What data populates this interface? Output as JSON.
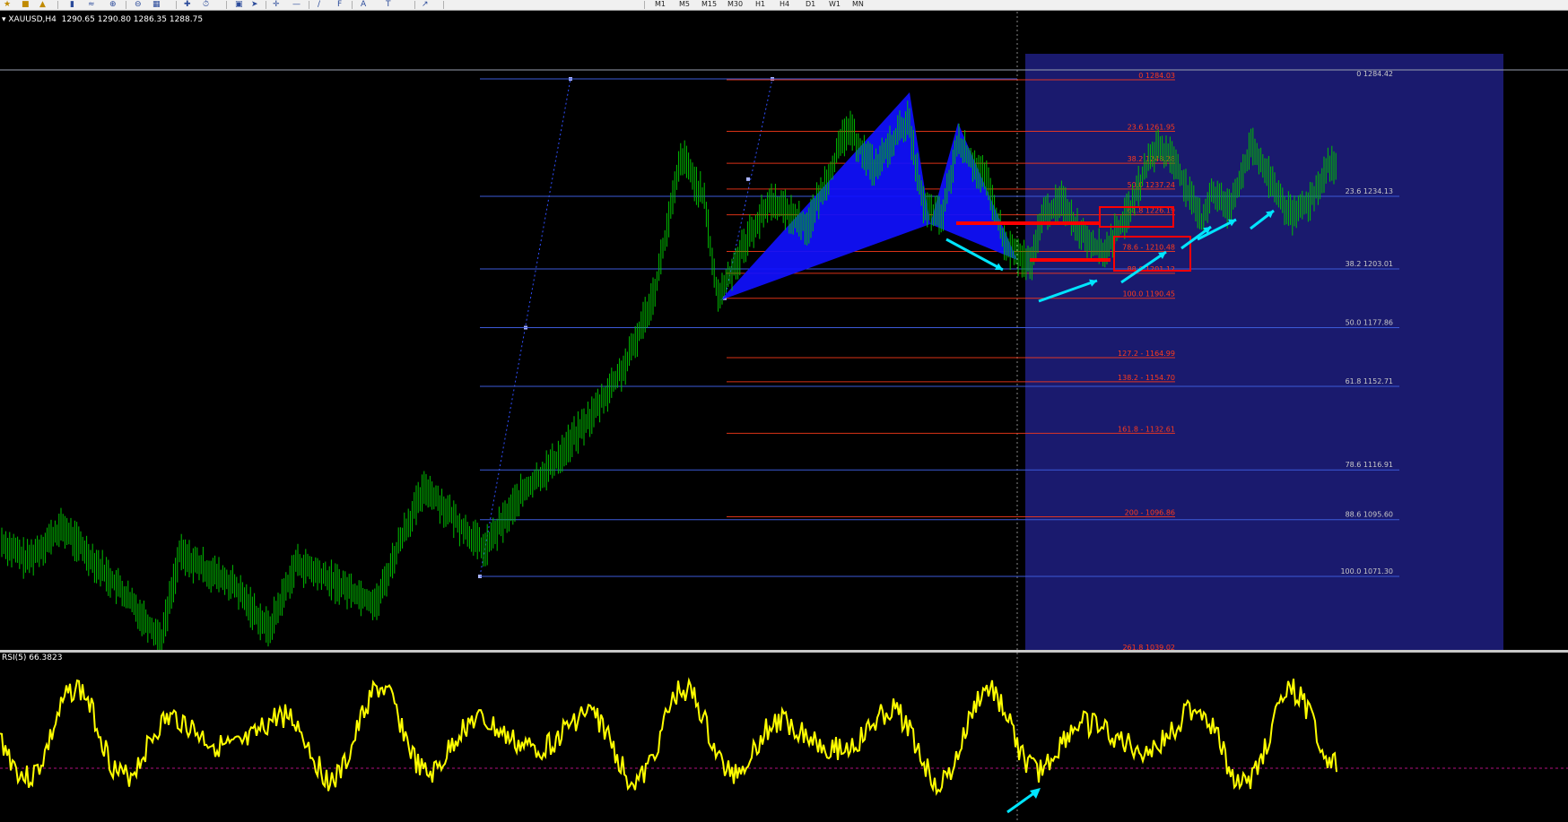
{
  "toolbar": {
    "timeframes": [
      "M1",
      "M5",
      "M15",
      "M30",
      "H1",
      "H4",
      "D1",
      "W1",
      "MN"
    ],
    "icons": [
      "new-order-icon",
      "profiles-icon",
      "bar-chart-icon",
      "candle-chart-icon",
      "line-chart-icon",
      "zoom-in-icon",
      "zoom-out-icon",
      "tile-icon",
      "indicators-icon",
      "periods-icon",
      "templates-icon",
      "cursor-icon",
      "crosshair-icon",
      "hline-icon",
      "trendline-icon",
      "fibo-icon",
      "text-icon",
      "label-icon",
      "arrow-icon"
    ]
  },
  "chart": {
    "header": "XAUUSD,H4  1290.65 1290.80 1286.35 1288.75",
    "symbol": "XAUUSD,H4",
    "ohlc": "1290.65 1290.80 1286.35 1288.75",
    "price_line_label": "0 1284.42",
    "fib_blue_levels": [
      {
        "label": "0 1284.42",
        "value": 1284.42
      },
      {
        "label": "23.6 1234.13",
        "value": 1234.13
      },
      {
        "label": "38.2 1203.01",
        "value": 1203.01
      },
      {
        "label": "50.0 1177.86",
        "value": 1177.86
      },
      {
        "label": "61.8 1152.71",
        "value": 1152.71
      },
      {
        "label": "78.6 1116.91",
        "value": 1116.91
      },
      {
        "label": "88.6 1095.60",
        "value": 1095.6
      },
      {
        "label": "100.0 1071.30",
        "value": 1071.3
      }
    ],
    "fib_red_levels": [
      {
        "label": "0 1284.03",
        "value": 1284.03
      },
      {
        "label": "23.6 1261.95",
        "value": 1261.95
      },
      {
        "label": "38.2 1248.28",
        "value": 1248.28
      },
      {
        "label": "50.0 1237.24",
        "value": 1237.24
      },
      {
        "label": "61.8 1226.19",
        "value": 1226.19
      },
      {
        "label": "78.6 - 1210.48",
        "value": 1210.48
      },
      {
        "label": "88.6 1201.12",
        "value": 1201.12
      },
      {
        "label": "100.0 1190.45",
        "value": 1190.45
      },
      {
        "label": "127.2 - 1164.99",
        "value": 1164.99
      },
      {
        "label": "138.2 - 1154.70",
        "value": 1154.7
      },
      {
        "label": "161.8 - 1132.61",
        "value": 1132.61
      },
      {
        "label": "200 - 1096.86",
        "value": 1096.86
      },
      {
        "label": "261.8 1039.02",
        "value": 1039.02
      }
    ],
    "colors": {
      "background": "#000000",
      "candles": "#00c000",
      "rsi_line": "#ffff00",
      "fib_blue": "#3c5ad8",
      "fib_red": "#ff3b1a",
      "pattern_fill": "#1010ff",
      "zone": "#1a1a6e",
      "arrows": "#00e5ff",
      "annotation": "#ff0000"
    }
  },
  "rsi": {
    "header": "RSI(5) 66.3823",
    "period": 5,
    "value": 66.3823
  }
}
